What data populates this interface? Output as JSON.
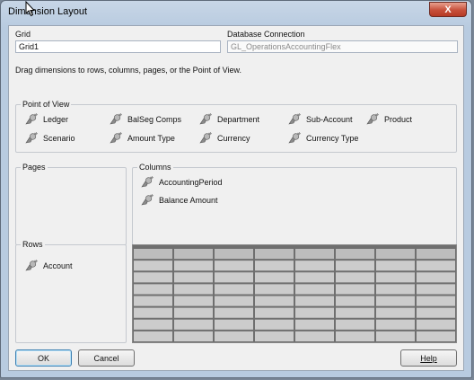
{
  "window": {
    "title": "Dimension Layout",
    "close_glyph": "X"
  },
  "grid": {
    "label": "Grid",
    "value": "Grid1"
  },
  "connection": {
    "label": "Database Connection",
    "value": "GL_OperationsAccountingFlex"
  },
  "instructions": "Drag dimensions to rows, columns, pages, or the Point of View.",
  "point_of_view": {
    "title": "Point of View",
    "items": [
      "Ledger",
      "BalSeg Comps",
      "Department",
      "Sub-Account",
      "Product",
      "Scenario",
      "Amount Type",
      "Currency",
      "Currency Type"
    ]
  },
  "pages": {
    "title": "Pages"
  },
  "columns": {
    "title": "Columns",
    "items": [
      "AccountingPeriod",
      "Balance Amount"
    ]
  },
  "rows": {
    "title": "Rows",
    "items": [
      "Account"
    ]
  },
  "buttons": {
    "ok": "OK",
    "cancel": "Cancel",
    "help": "Help"
  },
  "preview_grid": {
    "rows": 8,
    "cols": 8
  },
  "icons": {
    "dimension": "dimension-icon",
    "close": "close-icon",
    "cursor": "mouse-cursor-icon"
  },
  "colors": {
    "grid_fill": "#cccccc",
    "grid_header": "#bdbdbd",
    "close_button": "#c7503b"
  }
}
